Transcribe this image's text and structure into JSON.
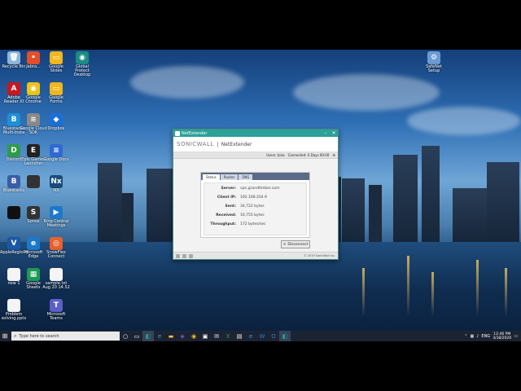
{
  "desktop_icons_left": [
    {
      "label": "Recycle Bin",
      "color": "#8fb7d9",
      "glyph": "🗑"
    },
    {
      "label": "Adobe Reader XI",
      "color": "#c8171e",
      "glyph": "A"
    },
    {
      "label": "Bluestacks Multi-Insta",
      "color": "#1e8fd8",
      "glyph": "B"
    },
    {
      "label": "Discord",
      "color": "#2e9c4a",
      "glyph": "D"
    },
    {
      "label": "Bluestacks",
      "color": "#3a5da8",
      "glyph": "B"
    },
    {
      "label": "",
      "color": "#111",
      "glyph": ""
    },
    {
      "label": "AppleRegistry",
      "color": "#1a58a5",
      "glyph": "V"
    },
    {
      "label": "new 1",
      "color": "#f4f4f4",
      "glyph": ""
    },
    {
      "label": "Problem solving.pptx",
      "color": "#f4f4f4",
      "glyph": ""
    }
  ],
  "desktop_icons_col2": [
    {
      "label": "Jabra...",
      "color": "#e24f2c",
      "glyph": "•"
    },
    {
      "label": "Google Chrome",
      "color": "#e8c51c",
      "glyph": "◉"
    },
    {
      "label": "Google Cloud SDK",
      "color": "#8a8a8a",
      "glyph": "≋"
    },
    {
      "label": "Epic Games Launcher",
      "color": "#222",
      "glyph": "E"
    },
    {
      "label": "",
      "color": "#333",
      "glyph": ""
    },
    {
      "label": "Sonos",
      "color": "#333",
      "glyph": "S"
    },
    {
      "label": "Microsoft Edge",
      "color": "#1d78c9",
      "glyph": "e"
    },
    {
      "label": "Google Sheets",
      "color": "#1d9a55",
      "glyph": "▦"
    }
  ],
  "desktop_icons_col3": [
    {
      "label": "Google Slides",
      "color": "#f2b71c",
      "glyph": "▭"
    },
    {
      "label": "Google Forms",
      "color": "#f2b71c",
      "glyph": "▭"
    },
    {
      "label": "Dropbox",
      "color": "#1d6fd8",
      "glyph": "◆"
    },
    {
      "label": "Google Docs",
      "color": "#2f6ad3",
      "glyph": "≡"
    },
    {
      "label": "NX",
      "color": "#1a4d7a",
      "glyph": "Nx"
    },
    {
      "label": "Ring Central Meetings",
      "color": "#1d78c9",
      "glyph": "▶"
    },
    {
      "label": "SnowFlex Connect",
      "color": "#e8602c",
      "glyph": "◎"
    },
    {
      "label": "sample.txt Aug 20 14.52",
      "color": "#f4f4f4",
      "glyph": ""
    },
    {
      "label": "Microsoft Teams",
      "color": "#5b5fc7",
      "glyph": "T"
    }
  ],
  "desktop_icons_col4": [
    {
      "label": "Global Protect Desktop",
      "color": "#1a8c83",
      "glyph": "◉"
    }
  ],
  "desktop_icon_right": {
    "label": "SafeNet Setup",
    "color": "#6b9bd1",
    "glyph": "⚙"
  },
  "window": {
    "title": "NetExtender",
    "brand": "SONICWALL",
    "product": "NetExtender",
    "status_left": "Users: bina",
    "status_connected": "Connected: 0 Days 00:00",
    "tabs": [
      "Status",
      "Routes",
      "DNS"
    ],
    "rows": [
      {
        "key": "Server:",
        "value": "vpn.grandtimber.com"
      },
      {
        "key": "Client IP:",
        "value": "192.168.204.9"
      },
      {
        "key": "Sent:",
        "value": "34,722 bytes"
      },
      {
        "key": "Received:",
        "value": "16,755 bytes"
      },
      {
        "key": "Throughput:",
        "value": "172 bytes/sec"
      }
    ],
    "disconnect_label": "Disconnect",
    "footer_copyright": "© 2019 SonicWall Inc."
  },
  "taskbar": {
    "search_placeholder": "Type here to search",
    "time": "12:46 PM",
    "date": "3/18/2020",
    "language": "ENG"
  }
}
